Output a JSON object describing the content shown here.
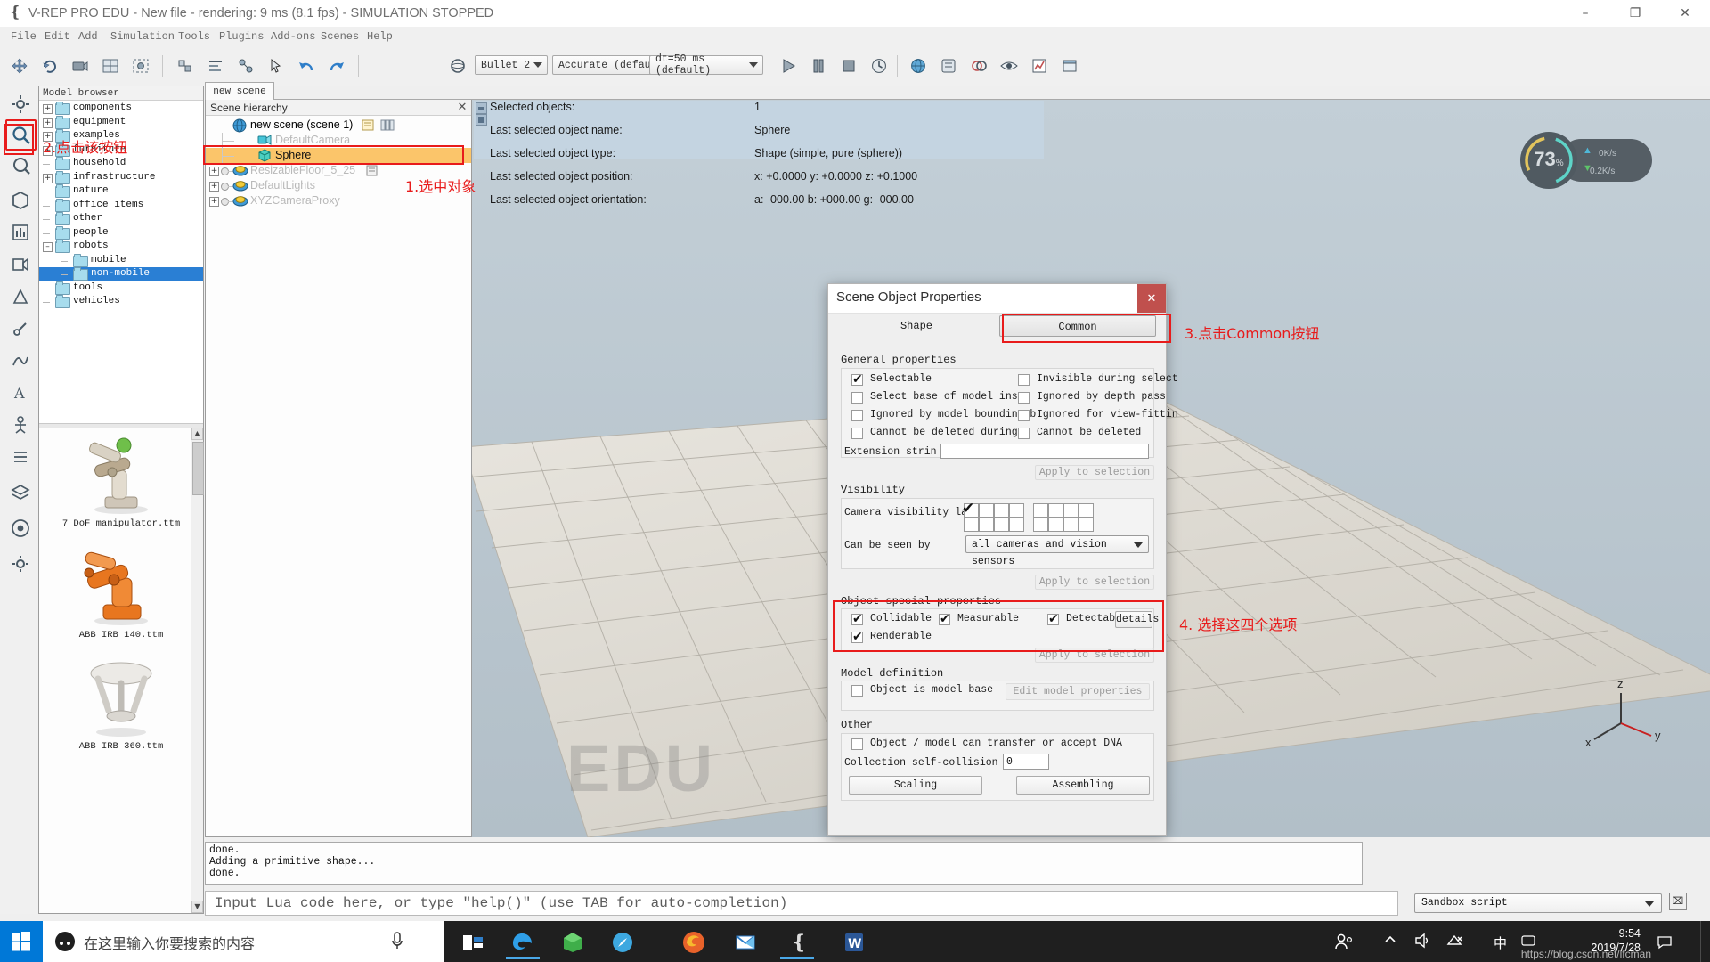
{
  "window": {
    "title": "V-REP PRO EDU - New file - rendering: 9 ms (8.1 fps) - SIMULATION STOPPED",
    "minimize": "–",
    "maximize": "❐",
    "close": "✕"
  },
  "menubar": {
    "items": [
      "File",
      "Edit",
      "Add",
      "Simulation",
      "Tools",
      "Plugins",
      "Add-ons",
      "Scenes",
      "Help"
    ]
  },
  "toolbar": {
    "engine_select": "Bullet 2",
    "accuracy_select": "Accurate (defau",
    "dt_select": "dt=50 ms (default)"
  },
  "model_browser": {
    "title": "Model browser",
    "tree": [
      {
        "label": "components",
        "depth": 0,
        "expander": "+",
        "selected": false
      },
      {
        "label": "equipment",
        "depth": 0,
        "expander": "+",
        "selected": false
      },
      {
        "label": "examples",
        "depth": 0,
        "expander": "+",
        "selected": false
      },
      {
        "label": "furniture",
        "depth": 0,
        "expander": "+",
        "selected": false
      },
      {
        "label": "household",
        "depth": 0,
        "expander": "",
        "selected": false
      },
      {
        "label": "infrastructure",
        "depth": 0,
        "expander": "+",
        "selected": false
      },
      {
        "label": "nature",
        "depth": 0,
        "expander": "",
        "selected": false
      },
      {
        "label": "office items",
        "depth": 0,
        "expander": "",
        "selected": false
      },
      {
        "label": "other",
        "depth": 0,
        "expander": "",
        "selected": false
      },
      {
        "label": "people",
        "depth": 0,
        "expander": "",
        "selected": false
      },
      {
        "label": "robots",
        "depth": 0,
        "expander": "–",
        "selected": false
      },
      {
        "label": "mobile",
        "depth": 1,
        "expander": "",
        "selected": false
      },
      {
        "label": "non-mobile",
        "depth": 1,
        "expander": "",
        "selected": true
      },
      {
        "label": "tools",
        "depth": 0,
        "expander": "",
        "selected": false
      },
      {
        "label": "vehicles",
        "depth": 0,
        "expander": "",
        "selected": false
      }
    ],
    "models": [
      {
        "name": "7 DoF manipulator.ttm"
      },
      {
        "name": "ABB IRB 140.ttm"
      },
      {
        "name": "ABB IRB 360.ttm"
      }
    ]
  },
  "scene_tabs": {
    "items": [
      "new scene"
    ],
    "active": "new scene"
  },
  "hierarchy": {
    "title": "Scene hierarchy",
    "close": "✕",
    "rows": [
      {
        "label": "new scene (scene 1)",
        "depth": 0,
        "expander": "",
        "icon": "scene-globe-icon",
        "dim": false,
        "selected": false
      },
      {
        "label": "DefaultCamera",
        "depth": 1,
        "expander": "",
        "icon": "camera-icon",
        "dim": true,
        "selected": false
      },
      {
        "label": "Sphere",
        "depth": 1,
        "expander": "",
        "icon": "shape-cube-icon",
        "dim": false,
        "selected": true
      },
      {
        "label": "ResizableFloor_5_25",
        "depth": 0,
        "expander": "+",
        "icon": "model-icon",
        "dim": true,
        "selected": false
      },
      {
        "label": "DefaultLights",
        "depth": 0,
        "expander": "+",
        "icon": "model-icon",
        "dim": true,
        "selected": false
      },
      {
        "label": "XYZCameraProxy",
        "depth": 0,
        "expander": "+",
        "icon": "model-icon",
        "dim": true,
        "selected": false
      }
    ]
  },
  "info_panel": {
    "rows": [
      {
        "key": "Selected objects:",
        "value": "1"
      },
      {
        "key": "Last selected object name:",
        "value": "Sphere"
      },
      {
        "key": "Last selected object type:",
        "value": "Shape (simple, pure (sphere))"
      },
      {
        "key": "Last selected object position:",
        "value": "x: +0.0000   y: +0.0000   z: +0.1000"
      },
      {
        "key": "Last selected object orientation:",
        "value": "a: -000.00   b: +000.00   g: -000.00"
      }
    ]
  },
  "viewport": {
    "watermark": "EDU",
    "axis_labels": {
      "x": "x",
      "y": "y",
      "z": "z"
    }
  },
  "net_widget": {
    "percent": "73",
    "percent_unit": "%",
    "up": "0",
    "up_unit": "K/s",
    "down": "0.2",
    "down_unit": "K/s"
  },
  "dialog": {
    "title": "Scene Object Properties",
    "close": "✕",
    "tabs": [
      {
        "label": "Shape",
        "active": false
      },
      {
        "label": "Common",
        "active": true
      }
    ],
    "general_properties": {
      "title": "General properties",
      "checkboxes": [
        {
          "label": "Selectable",
          "checked": true,
          "col": 0
        },
        {
          "label": "Select base of model insŧ",
          "checked": false,
          "col": 0
        },
        {
          "label": "Ignored by model bounding  b",
          "checked": false,
          "col": 0
        },
        {
          "label": "Cannot be deleted during s",
          "checked": false,
          "col": 0
        },
        {
          "label": "Invisible during select",
          "checked": false,
          "col": 1
        },
        {
          "label": "Ignored by depth pass",
          "checked": false,
          "col": 1
        },
        {
          "label": "Ignored for view-fittin",
          "checked": false,
          "col": 1
        },
        {
          "label": "Cannot be deleted",
          "checked": false,
          "col": 1
        }
      ],
      "extension_label": "Extension strin",
      "extension_value": "",
      "apply_label": "Apply to selection"
    },
    "visibility": {
      "title": "Visibility",
      "layers_label": "Camera visibility laye",
      "layer_first_checked": true,
      "seen_by_label": "Can be seen by",
      "seen_by_value": "all cameras and vision sensors",
      "apply_label": "Apply to selection"
    },
    "special_properties": {
      "title": "Object special properties",
      "checkboxes": [
        {
          "label": "Collidable",
          "checked": true
        },
        {
          "label": "Measurable",
          "checked": true
        },
        {
          "label": "Detectabl",
          "checked": true
        },
        {
          "label": "Renderable",
          "checked": true
        }
      ],
      "details_button": "details",
      "apply_label": "Apply to selection"
    },
    "model_definition": {
      "title": "Model definition",
      "checkbox_label": "Object is model base",
      "checkbox_checked": false,
      "edit_button": "Edit model properties"
    },
    "other": {
      "title": "Other",
      "dna_label": "Object / model can transfer or accept DNA",
      "dna_checked": false,
      "collection_label": "Collection self-collision i",
      "collection_value": "0",
      "scaling_button": "Scaling",
      "assembling_button": "Assembling"
    }
  },
  "annotations": [
    {
      "id": "a1",
      "text": "1.选中对象"
    },
    {
      "id": "a2",
      "text": "2.点击该按钮"
    },
    {
      "id": "a3",
      "text": "3.点击Common按钮"
    },
    {
      "id": "a4",
      "text": "4. 选择这四个选项"
    }
  ],
  "console": {
    "lines": [
      "done.",
      "Adding a primitive shape...",
      "done."
    ]
  },
  "lua_bar": {
    "placeholder": "Input Lua code here, or type \"help()\" (use TAB for auto-completion)",
    "script_select": "Sandbox script",
    "close": "⌧"
  },
  "taskbar": {
    "search_placeholder": "在这里输入你要搜索的内容",
    "apps": [
      "task-view",
      "edge",
      "store",
      "tool-app",
      "firefox",
      "mail",
      "vrep",
      "word"
    ],
    "ime": "中",
    "clock_time": "9:54",
    "clock_date": "2019/7/28",
    "watermark": "https://blog.csdn.net/lfcman"
  },
  "colors": {
    "selection_orange": "#fbc56a",
    "tree_selection_blue": "#2a7fd4",
    "annotation_red": "#e81b1b",
    "dialog_close_red": "#c0504d",
    "taskbar_blue": "#0078d7"
  }
}
